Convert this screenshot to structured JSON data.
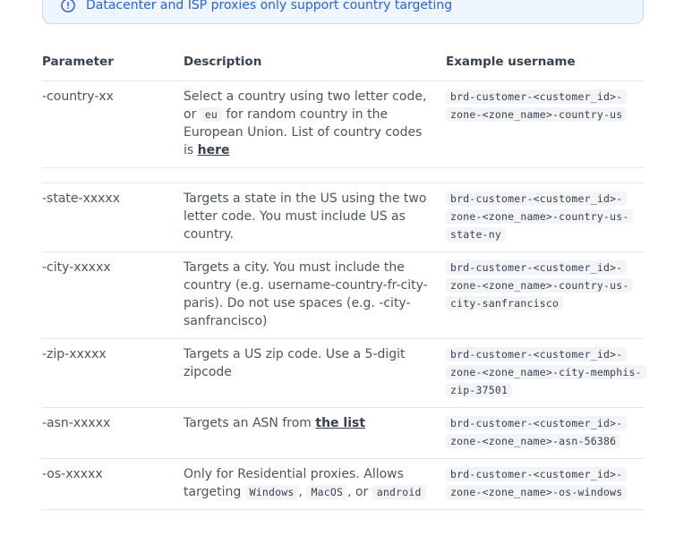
{
  "callout": {
    "icon": "info-icon",
    "text": "Datacenter and ISP proxies only support country targeting",
    "color": "#2563eb"
  },
  "table": {
    "headers": [
      "Parameter",
      "Description",
      "Example username"
    ],
    "rows": [
      {
        "param": "-country-xx",
        "desc_parts": [
          "Select a country using two letter code, or",
          "eu",
          "for random country in the European Union. List of country codes is",
          "here"
        ],
        "example": "brd-customer-<customer_id>-zone-<zone_name>-country-us"
      },
      {
        "param": "-state-xxxxx",
        "desc": "Targets a state in the US using the two letter code. You must include US as country.",
        "example": "brd-customer-<customer_id>-zone-<zone_name>-country-us-state-ny"
      },
      {
        "param": "-city-xxxxx",
        "desc": "Targets a city. You must include the country (e.g. username-country-fr-city-paris). Do not use spaces (e.g. -city-sanfrancisco)",
        "example": "brd-customer-<customer_id>-zone-<zone_name>-country-us-city-sanfrancisco"
      },
      {
        "param": "-zip-xxxxx",
        "desc": "Targets a US zip code. Use a 5-digit zipcode",
        "example": "brd-customer-<customer_id>-zone-<zone_name>-city-memphis-zip-37501"
      },
      {
        "param": "-asn-xxxxx",
        "desc_parts": [
          "Targets an ASN from",
          "the list"
        ],
        "example": "brd-customer-<customer_id>-zone-<zone_name>-asn-56386"
      },
      {
        "param": "-os-xxxxx",
        "desc_parts": [
          "Only for Residential proxies. Allows targeting",
          "Windows",
          ",",
          "MacOS",
          ", or",
          "android"
        ],
        "example": "brd-customer-<customer_id>-zone-<zone_name>-os-windows"
      }
    ]
  }
}
